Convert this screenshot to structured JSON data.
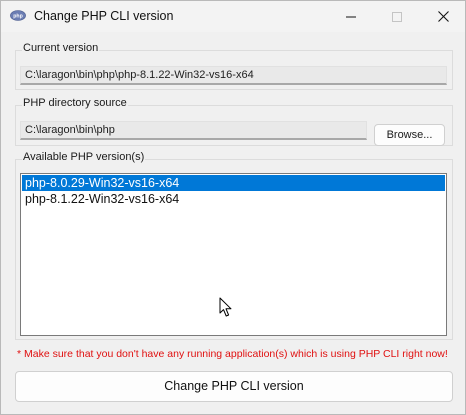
{
  "window": {
    "title": "Change PHP CLI version",
    "icon": "php-icon",
    "controls": {
      "minimize": "minimize-icon",
      "maximize": "maximize-icon",
      "close": "close-icon"
    }
  },
  "current_version": {
    "label": "Current version",
    "value": "C:\\laragon\\bin\\php\\php-8.1.22-Win32-vs16-x64"
  },
  "directory_source": {
    "label": "PHP directory source",
    "value": "C:\\laragon\\bin\\php",
    "browse_label": "Browse..."
  },
  "available_versions": {
    "label": "Available PHP version(s)",
    "items": [
      {
        "label": "php-8.0.29-Win32-vs16-x64",
        "selected": true
      },
      {
        "label": "php-8.1.22-Win32-vs16-x64",
        "selected": false
      }
    ]
  },
  "warning": "* Make sure that you don't have any running application(s) which is using PHP CLI right now!",
  "action_button": "Change PHP CLI version",
  "colors": {
    "selection": "#0078d7",
    "warning": "#e01010"
  }
}
